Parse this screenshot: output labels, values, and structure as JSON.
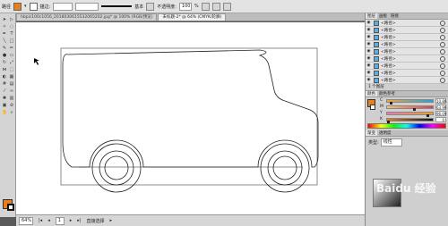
{
  "controlbar": {
    "selection_label": "路径",
    "stroke_label": "描边:",
    "brush_label": "基本",
    "opacity_label": "不透明度:",
    "opacity_value": "100",
    "percent_sign": "%",
    "fill_color": "#e87f1a",
    "stroke_color": "#ffffff"
  },
  "tabs": [
    {
      "label": "hbpic100c1056_2018030615532065202.jpg* @ 100% (RGB/预览)",
      "active": false
    },
    {
      "label": "未标题-2* @ 64% (CMYK/轮廓)",
      "active": true
    }
  ],
  "status": {
    "zoom": "64%",
    "page": "1",
    "tool_label": "直接选择"
  },
  "panels": {
    "tabs": [
      "图层",
      "画板",
      "链接"
    ],
    "layers": [
      {
        "label": "<路径>"
      },
      {
        "label": "<路径>"
      },
      {
        "label": "<路径>"
      },
      {
        "label": "<路径>"
      },
      {
        "label": "<路径>"
      },
      {
        "label": "<路径>"
      },
      {
        "label": "<路径>"
      },
      {
        "label": "<路径>"
      },
      {
        "label": "<路径>"
      }
    ],
    "layer_count_label": "1 个图层",
    "color_tabs": [
      "颜色",
      "颜色参考"
    ],
    "channels": [
      {
        "name": "C",
        "value": "10.86"
      },
      {
        "name": "M",
        "value": "63.96"
      },
      {
        "name": "Y",
        "value": "96.09"
      },
      {
        "name": "K",
        "value": "0"
      }
    ],
    "gradient_tabs": [
      "渐变",
      "透明度"
    ],
    "gradient_type_label": "类型:",
    "gradient_type_value": "线性",
    "watermark": "Baidu 经验"
  }
}
